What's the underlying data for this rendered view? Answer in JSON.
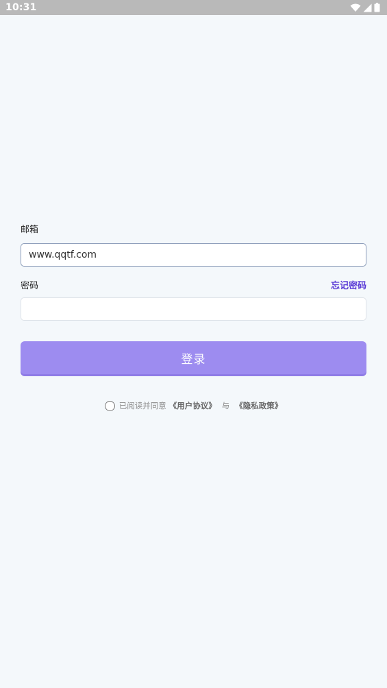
{
  "status_bar": {
    "time": "10:31",
    "icons": [
      "wifi-icon",
      "cell-signal-icon",
      "battery-icon"
    ]
  },
  "login_form": {
    "email_label": "邮箱",
    "email_value": "www.qqtf.com",
    "password_label": "密码",
    "forgot_password_label": "忘记密码",
    "password_value": "",
    "login_button_label": "登录"
  },
  "agreement": {
    "prefix": "已阅读并同意",
    "user_agreement": "《用户协议》",
    "connector": "与",
    "privacy_policy": "《隐私政策》",
    "checked": false
  },
  "colors": {
    "accent": "#9d8cf0",
    "link": "#5a3bd6",
    "background": "#f4f8fb",
    "status_bar": "#b9b9b9"
  }
}
